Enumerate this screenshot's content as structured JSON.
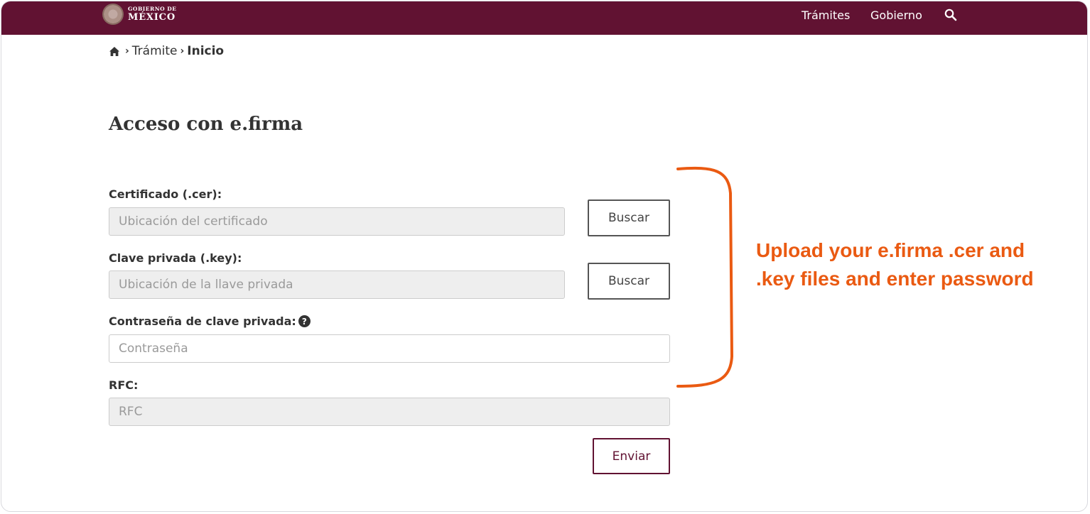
{
  "header": {
    "logo_top": "GOBIERNO DE",
    "logo_bottom": "MÉXICO",
    "nav": [
      "Trámites",
      "Gobierno"
    ],
    "search_icon": "search-icon"
  },
  "breadcrumb": {
    "home_icon": "home-icon",
    "items": [
      "Trámite",
      "Inicio"
    ],
    "separator": "›"
  },
  "page": {
    "title": "Acceso con e.firma"
  },
  "form": {
    "certificate": {
      "label": "Certificado (.cer):",
      "placeholder": "Ubicación del certificado",
      "button": "Buscar"
    },
    "private_key": {
      "label": "Clave privada (.key):",
      "placeholder": "Ubicación de la llave privada",
      "button": "Buscar"
    },
    "password": {
      "label": "Contraseña de clave privada:",
      "placeholder": "Contraseña",
      "help_icon": "question-circle-icon"
    },
    "rfc": {
      "label": "RFC:",
      "placeholder": "RFC"
    },
    "submit": "Enviar"
  },
  "annotation": {
    "text": "Upload your e.firma .cer and .key files and enter password"
  },
  "colors": {
    "brand": "#611232",
    "annotation": "#ea5a12",
    "text": "#333333",
    "disabled_input": "#eeeeee"
  }
}
